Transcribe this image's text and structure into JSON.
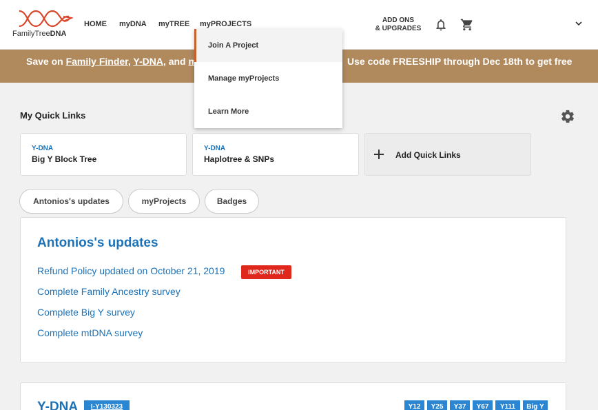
{
  "header": {
    "logo_text_a": "FamilyTree",
    "logo_text_b": "DNA",
    "nav": [
      "HOME",
      "myDNA",
      "myTREE",
      "myPROJECTS"
    ],
    "addons_line1": "ADD ONS",
    "addons_line2": "& UPGRADES",
    "icons": {
      "notifications": "bell-icon",
      "cart": "cart-icon",
      "profile_menu": "chevron-down-icon"
    }
  },
  "promo": {
    "prefix": "Save on ",
    "link1": "Family Finder",
    "sep1": ", ",
    "link2": "Y-DNA",
    "sep2": ", and ",
    "link3": "m",
    "right_text": "Use code FREESHIP through Dec 18th to get free"
  },
  "dropdown": {
    "items": [
      "Join A Project",
      "Manage myProjects",
      "Learn More"
    ]
  },
  "quick_links": {
    "title": "My Quick Links",
    "cards": [
      {
        "category": "Y-DNA",
        "name": "Big Y Block Tree"
      },
      {
        "category": "Y-DNA",
        "name": "Haplotree & SNPs"
      }
    ],
    "add_label": "Add Quick Links"
  },
  "tabs": [
    "Antonios's updates",
    "myProjects",
    "Badges"
  ],
  "updates": {
    "title": "Antonios's updates",
    "items": [
      "Refund Policy updated on October 21, 2019",
      "Complete Family Ancestry survey",
      "Complete Big Y survey",
      "Complete mtDNA survey"
    ],
    "important_badge": "IMPORTANT"
  },
  "ydna": {
    "title": "Y-DNA",
    "haplogroup": "I-Y130323",
    "tests": [
      "Y12",
      "Y25",
      "Y37",
      "Y67",
      "Y111",
      "Big Y"
    ]
  },
  "colors": {
    "accent_blue": "#1b72b8",
    "promo_bg": "#b0895d",
    "important_red": "#e0271c",
    "logo_orange": "#d9472b"
  }
}
